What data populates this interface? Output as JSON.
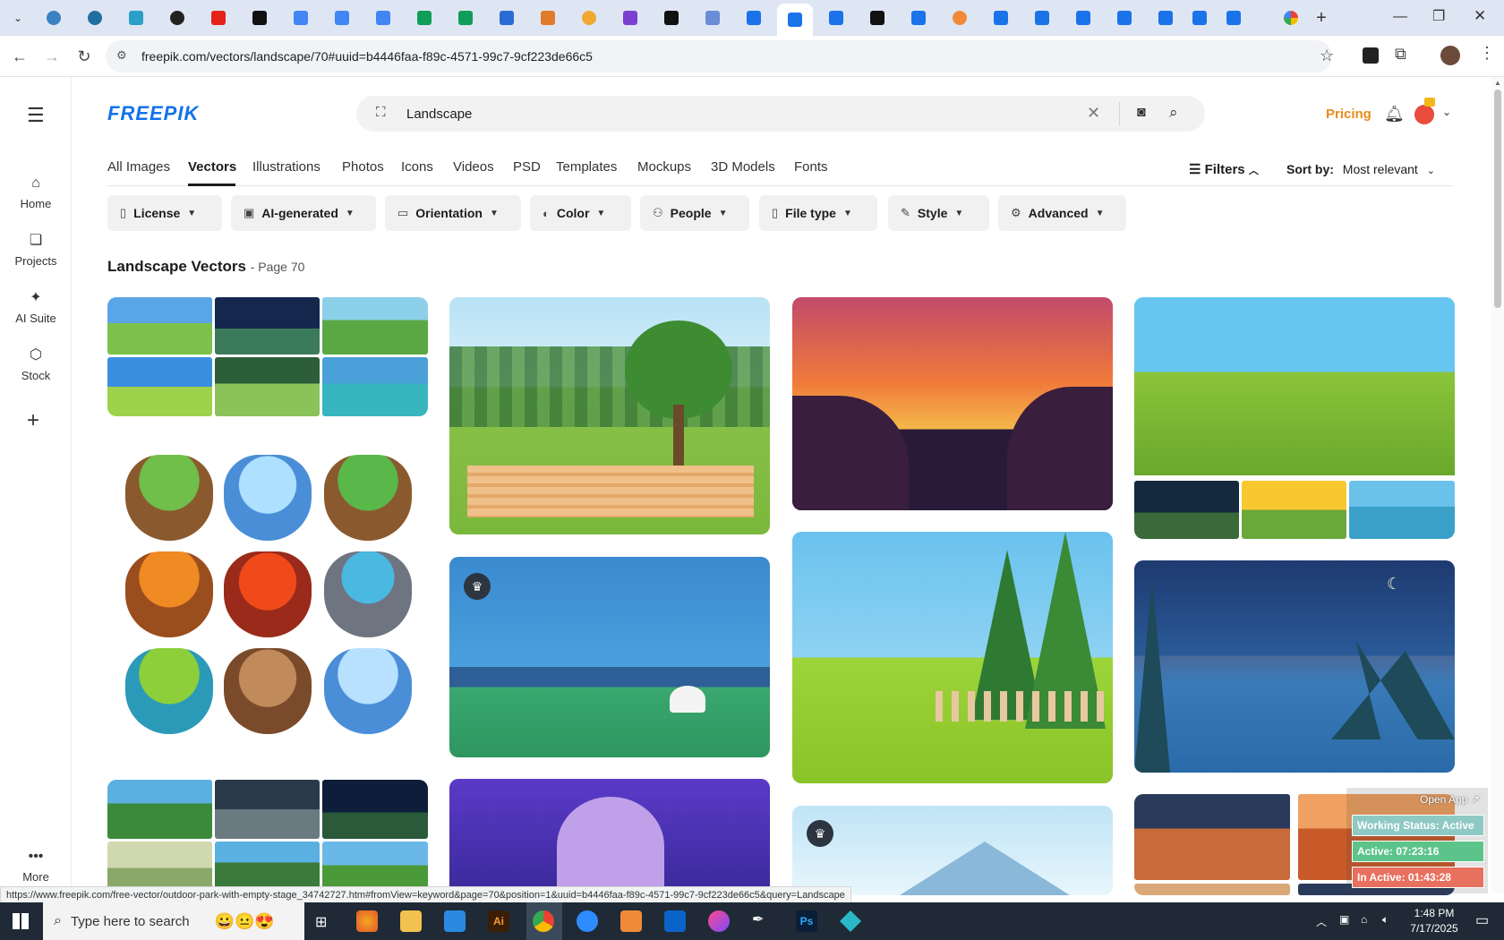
{
  "browser": {
    "address": "freepik.com/vectors/landscape/70#uuid=b4446faa-f89c-4571-99c7-9cf223de66c5",
    "status_link": "https://www.freepik.com/free-vector/outdoor-park-with-empty-stage_34742727.htm#fromView=keyword&page=70&position=1&uuid=b4446faa-f89c-4571-99c7-9cf223de66c5&query=Landscape"
  },
  "sidebar": {
    "items": [
      {
        "label": "Home",
        "icon": "home-icon"
      },
      {
        "label": "Projects",
        "icon": "projects-icon"
      },
      {
        "label": "AI Suite",
        "icon": "sparkle-icon"
      },
      {
        "label": "Stock",
        "icon": "stock-icon"
      }
    ],
    "more": "More"
  },
  "header": {
    "logo": "FREEPIK",
    "search_value": "Landscape",
    "pricing": "Pricing"
  },
  "type_tabs": [
    "All Images",
    "Vectors",
    "Illustrations",
    "Photos",
    "Icons",
    "Videos",
    "PSD",
    "Templates",
    "Mockups",
    "3D Models",
    "Fonts"
  ],
  "filters_button": "Filters",
  "sort": {
    "label": "Sort by:",
    "value": "Most relevant"
  },
  "filters": [
    "License",
    "AI-generated",
    "Orientation",
    "Color",
    "People",
    "File type",
    "Style",
    "Advanced"
  ],
  "results": {
    "title": "Landscape Vectors",
    "page": "- Page 70"
  },
  "widget": {
    "open_app": "Open App ↗",
    "status": "Working Status: Active",
    "active": "Active: 07:23:16",
    "inactive": "In Active: 01:43:28"
  },
  "taskbar": {
    "search_placeholder": "Type here to search",
    "time": "1:48 PM",
    "date": "7/17/2025"
  },
  "colors": {
    "brand": "#1273eb",
    "pricing": "#e88b1a",
    "widget_green": "#5cc48a",
    "widget_red": "#e8705f"
  }
}
